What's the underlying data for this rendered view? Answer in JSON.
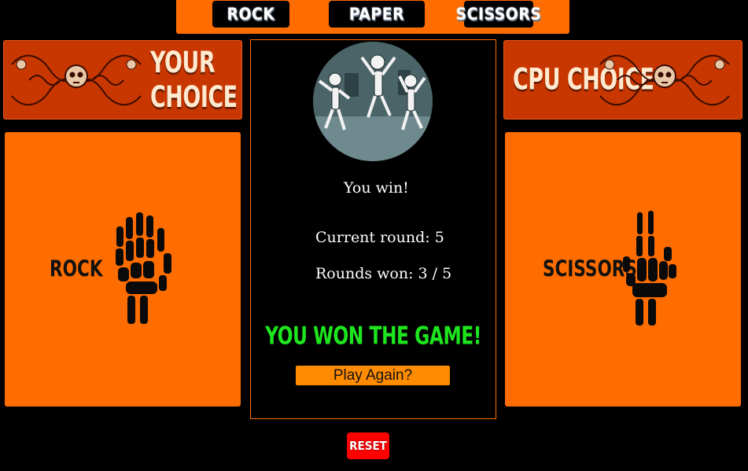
{
  "choices": {
    "rock_label": "ROCK",
    "paper_label": "PAPER",
    "scissors_label": "SCISSORS"
  },
  "player": {
    "banner_title": "YOUR CHOICE",
    "choice_label": "ROCK",
    "hand_icon": "skeleton-fist-icon"
  },
  "cpu": {
    "banner_title": "CPU CHOICE",
    "choice_label": "SCISSORS",
    "hand_icon": "skeleton-peace-icon"
  },
  "status": {
    "round_result": "You win!",
    "current_round": "Current round: 5",
    "rounds_won": "Rounds won: 3 / 5",
    "game_result": "YOU WON THE GAME!",
    "play_again_label": "Play Again?"
  },
  "reset_label": "RESET",
  "colors": {
    "accent": "#ff6d00",
    "banner": "#c83700",
    "win_text": "#1ee61e",
    "reset": "#ff0000",
    "background": "#000000"
  }
}
